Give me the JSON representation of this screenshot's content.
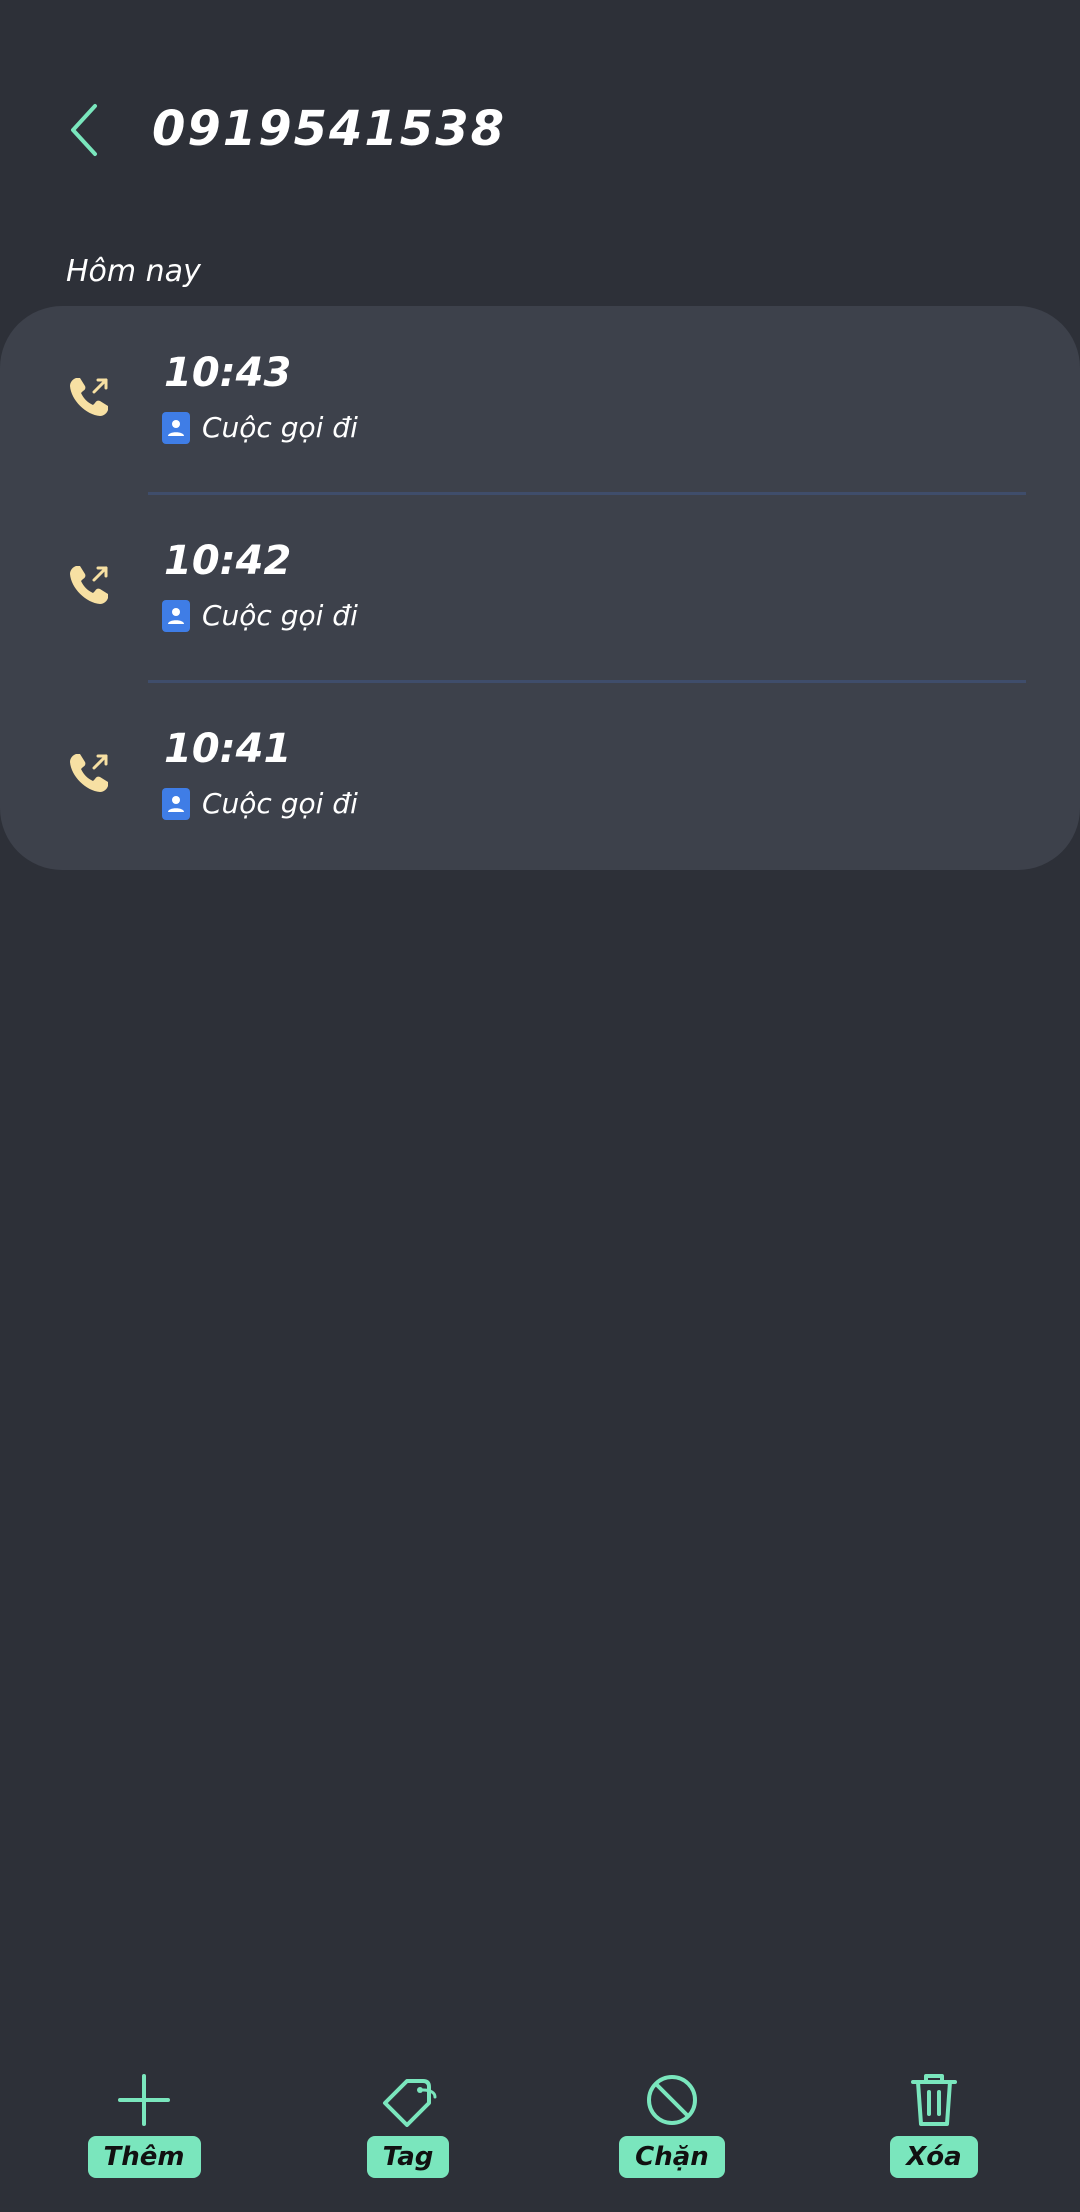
{
  "header": {
    "title": "0919541538",
    "back_icon": "chevron-left-icon"
  },
  "section": {
    "label": "Hôm nay"
  },
  "calls": [
    {
      "time": "10:43",
      "type": "Cuộc gọi đi",
      "icon": "outgoing-call-icon"
    },
    {
      "time": "10:42",
      "type": "Cuộc gọi đi",
      "icon": "outgoing-call-icon"
    },
    {
      "time": "10:41",
      "type": "Cuộc gọi đi",
      "icon": "outgoing-call-icon"
    }
  ],
  "actions": [
    {
      "label": "Thêm",
      "icon": "plus-icon"
    },
    {
      "label": "Tag",
      "icon": "tag-icon"
    },
    {
      "label": "Chặn",
      "icon": "block-icon"
    },
    {
      "label": "Xóa",
      "icon": "trash-icon"
    }
  ],
  "colors": {
    "background": "#2d3038",
    "card": "#3d414b",
    "accent": "#7ae6bd",
    "call_icon": "#f7e0a3",
    "contact_icon": "#3f7de6"
  }
}
